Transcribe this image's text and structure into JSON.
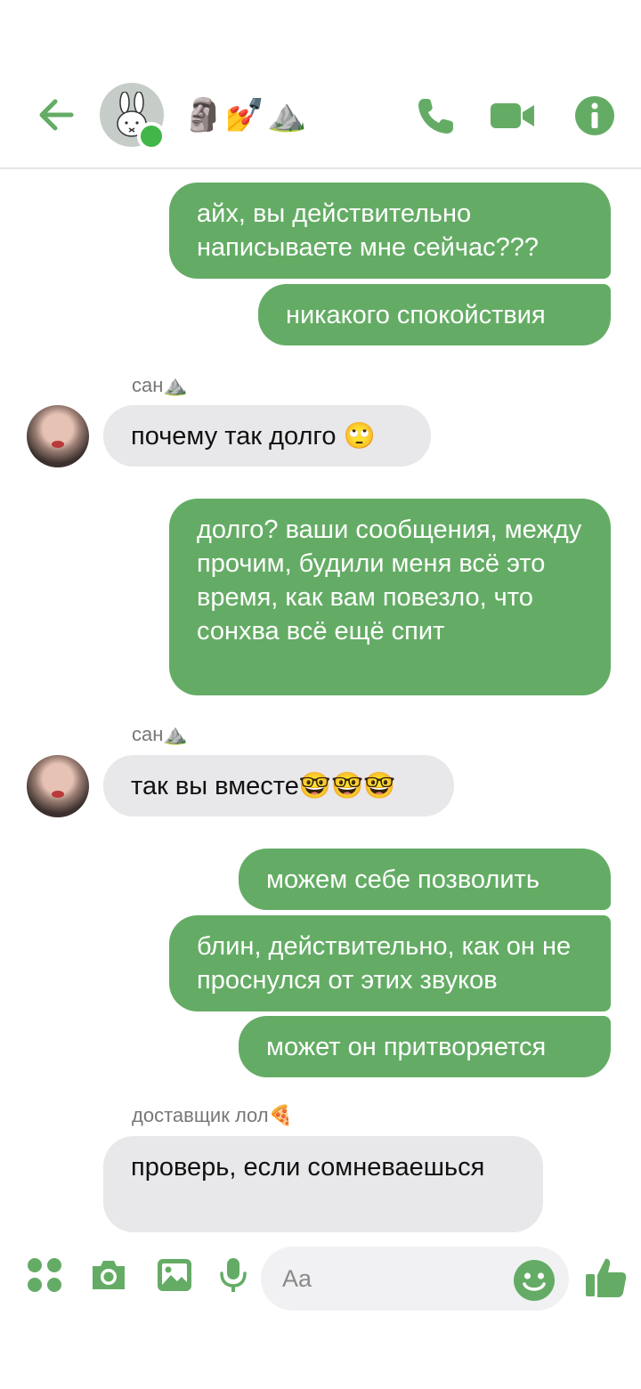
{
  "colors": {
    "accent": "#64ac65",
    "incoming": "#e8e8eb",
    "online": "#43b649"
  },
  "header": {
    "title": "🗿💅⛰️",
    "icons": [
      "back-arrow-icon",
      "phone-icon",
      "video-camera-icon",
      "info-icon"
    ],
    "online": true
  },
  "messages": [
    {
      "dir": "out",
      "text": "айх, вы действительно написываете мне сейчас???"
    },
    {
      "dir": "out",
      "text": "никакого спокойствия"
    },
    {
      "dir": "in",
      "sender": "сан⛰️",
      "text": "почему так долго 🙄"
    },
    {
      "dir": "out",
      "text": "долго? ваши сообщения, между прочим, будили меня всё это время, как вам повезло, что сонхва всё ещё спит"
    },
    {
      "dir": "in",
      "sender": "сан⛰️",
      "text": "так вы вместе🤓🤓🤓"
    },
    {
      "dir": "out",
      "text": "можем себе позволить"
    },
    {
      "dir": "out",
      "text": "блин, действительно, как он не проснулся от этих звуков"
    },
    {
      "dir": "out",
      "text": "может он притворяется"
    },
    {
      "dir": "in",
      "sender": "доставщик лол🍕",
      "text": "проверь, если сомневаешься"
    }
  ],
  "composer": {
    "placeholder": "Aa",
    "icons": [
      "apps-icon",
      "camera-icon",
      "gallery-icon",
      "microphone-icon",
      "emoji-icon",
      "thumbs-up-icon"
    ]
  }
}
